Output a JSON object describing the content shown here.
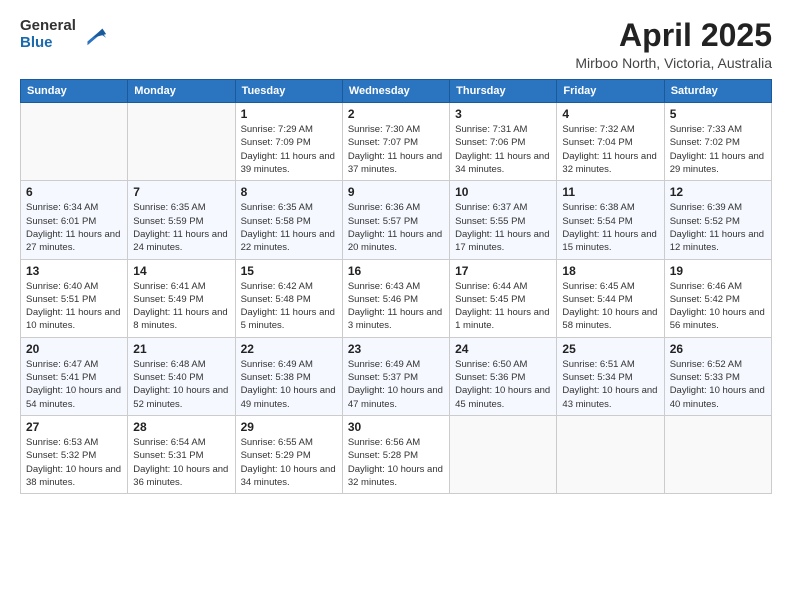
{
  "header": {
    "logo_general": "General",
    "logo_blue": "Blue",
    "title": "April 2025",
    "location": "Mirboo North, Victoria, Australia"
  },
  "weekdays": [
    "Sunday",
    "Monday",
    "Tuesday",
    "Wednesday",
    "Thursday",
    "Friday",
    "Saturday"
  ],
  "weeks": [
    [
      {
        "day": "",
        "info": ""
      },
      {
        "day": "",
        "info": ""
      },
      {
        "day": "1",
        "info": "Sunrise: 7:29 AM\nSunset: 7:09 PM\nDaylight: 11 hours and 39 minutes."
      },
      {
        "day": "2",
        "info": "Sunrise: 7:30 AM\nSunset: 7:07 PM\nDaylight: 11 hours and 37 minutes."
      },
      {
        "day": "3",
        "info": "Sunrise: 7:31 AM\nSunset: 7:06 PM\nDaylight: 11 hours and 34 minutes."
      },
      {
        "day": "4",
        "info": "Sunrise: 7:32 AM\nSunset: 7:04 PM\nDaylight: 11 hours and 32 minutes."
      },
      {
        "day": "5",
        "info": "Sunrise: 7:33 AM\nSunset: 7:02 PM\nDaylight: 11 hours and 29 minutes."
      }
    ],
    [
      {
        "day": "6",
        "info": "Sunrise: 6:34 AM\nSunset: 6:01 PM\nDaylight: 11 hours and 27 minutes."
      },
      {
        "day": "7",
        "info": "Sunrise: 6:35 AM\nSunset: 5:59 PM\nDaylight: 11 hours and 24 minutes."
      },
      {
        "day": "8",
        "info": "Sunrise: 6:35 AM\nSunset: 5:58 PM\nDaylight: 11 hours and 22 minutes."
      },
      {
        "day": "9",
        "info": "Sunrise: 6:36 AM\nSunset: 5:57 PM\nDaylight: 11 hours and 20 minutes."
      },
      {
        "day": "10",
        "info": "Sunrise: 6:37 AM\nSunset: 5:55 PM\nDaylight: 11 hours and 17 minutes."
      },
      {
        "day": "11",
        "info": "Sunrise: 6:38 AM\nSunset: 5:54 PM\nDaylight: 11 hours and 15 minutes."
      },
      {
        "day": "12",
        "info": "Sunrise: 6:39 AM\nSunset: 5:52 PM\nDaylight: 11 hours and 12 minutes."
      }
    ],
    [
      {
        "day": "13",
        "info": "Sunrise: 6:40 AM\nSunset: 5:51 PM\nDaylight: 11 hours and 10 minutes."
      },
      {
        "day": "14",
        "info": "Sunrise: 6:41 AM\nSunset: 5:49 PM\nDaylight: 11 hours and 8 minutes."
      },
      {
        "day": "15",
        "info": "Sunrise: 6:42 AM\nSunset: 5:48 PM\nDaylight: 11 hours and 5 minutes."
      },
      {
        "day": "16",
        "info": "Sunrise: 6:43 AM\nSunset: 5:46 PM\nDaylight: 11 hours and 3 minutes."
      },
      {
        "day": "17",
        "info": "Sunrise: 6:44 AM\nSunset: 5:45 PM\nDaylight: 11 hours and 1 minute."
      },
      {
        "day": "18",
        "info": "Sunrise: 6:45 AM\nSunset: 5:44 PM\nDaylight: 10 hours and 58 minutes."
      },
      {
        "day": "19",
        "info": "Sunrise: 6:46 AM\nSunset: 5:42 PM\nDaylight: 10 hours and 56 minutes."
      }
    ],
    [
      {
        "day": "20",
        "info": "Sunrise: 6:47 AM\nSunset: 5:41 PM\nDaylight: 10 hours and 54 minutes."
      },
      {
        "day": "21",
        "info": "Sunrise: 6:48 AM\nSunset: 5:40 PM\nDaylight: 10 hours and 52 minutes."
      },
      {
        "day": "22",
        "info": "Sunrise: 6:49 AM\nSunset: 5:38 PM\nDaylight: 10 hours and 49 minutes."
      },
      {
        "day": "23",
        "info": "Sunrise: 6:49 AM\nSunset: 5:37 PM\nDaylight: 10 hours and 47 minutes."
      },
      {
        "day": "24",
        "info": "Sunrise: 6:50 AM\nSunset: 5:36 PM\nDaylight: 10 hours and 45 minutes."
      },
      {
        "day": "25",
        "info": "Sunrise: 6:51 AM\nSunset: 5:34 PM\nDaylight: 10 hours and 43 minutes."
      },
      {
        "day": "26",
        "info": "Sunrise: 6:52 AM\nSunset: 5:33 PM\nDaylight: 10 hours and 40 minutes."
      }
    ],
    [
      {
        "day": "27",
        "info": "Sunrise: 6:53 AM\nSunset: 5:32 PM\nDaylight: 10 hours and 38 minutes."
      },
      {
        "day": "28",
        "info": "Sunrise: 6:54 AM\nSunset: 5:31 PM\nDaylight: 10 hours and 36 minutes."
      },
      {
        "day": "29",
        "info": "Sunrise: 6:55 AM\nSunset: 5:29 PM\nDaylight: 10 hours and 34 minutes."
      },
      {
        "day": "30",
        "info": "Sunrise: 6:56 AM\nSunset: 5:28 PM\nDaylight: 10 hours and 32 minutes."
      },
      {
        "day": "",
        "info": ""
      },
      {
        "day": "",
        "info": ""
      },
      {
        "day": "",
        "info": ""
      }
    ]
  ]
}
